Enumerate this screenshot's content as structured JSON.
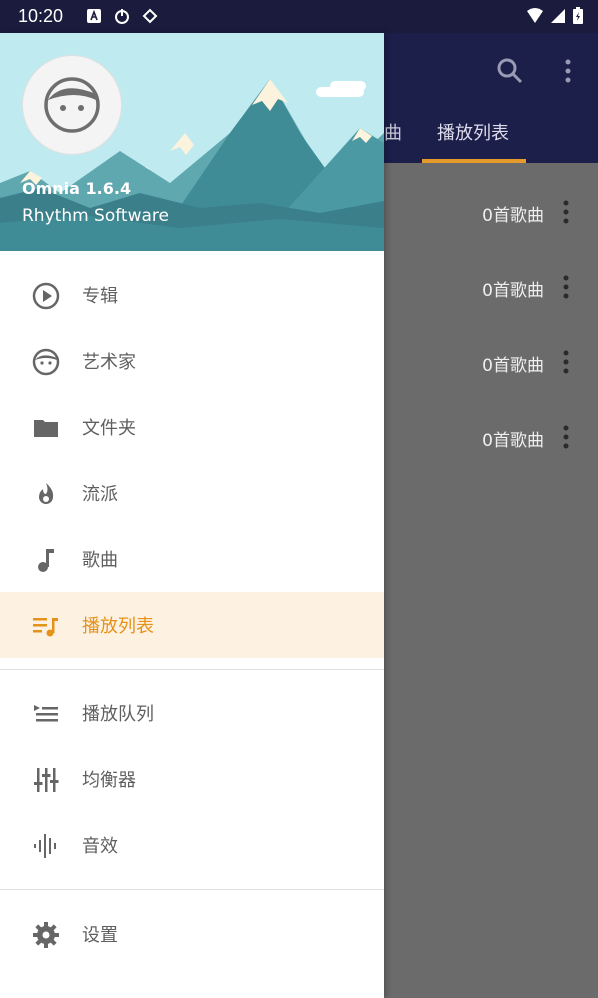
{
  "status_bar": {
    "time": "10:20"
  },
  "background_app": {
    "tabs": [
      {
        "label": "曲"
      },
      {
        "label": "播放列表"
      }
    ],
    "rows": [
      {
        "count": "0首歌曲"
      },
      {
        "count": "0首歌曲"
      },
      {
        "count": "0首歌曲"
      },
      {
        "count": "0首歌曲"
      }
    ]
  },
  "drawer": {
    "app_name": "Omnia 1.6.4",
    "company": "Rhythm Software",
    "items": [
      {
        "label": "专辑",
        "icon": "play-circle-icon"
      },
      {
        "label": "艺术家",
        "icon": "face-icon"
      },
      {
        "label": "文件夹",
        "icon": "folder-icon"
      },
      {
        "label": "流派",
        "icon": "flame-icon"
      },
      {
        "label": "歌曲",
        "icon": "music-note-icon"
      },
      {
        "label": "播放列表",
        "icon": "playlist-icon",
        "active": true
      },
      {
        "label": "播放队列",
        "icon": "queue-icon"
      },
      {
        "label": "均衡器",
        "icon": "equalizer-icon"
      },
      {
        "label": "音效",
        "icon": "waveform-icon"
      },
      {
        "label": "设置",
        "icon": "gear-icon"
      }
    ]
  },
  "colors": {
    "accent": "#e5921a",
    "appbar": "#1b1f4a",
    "active_bg": "#fdf1e2"
  }
}
